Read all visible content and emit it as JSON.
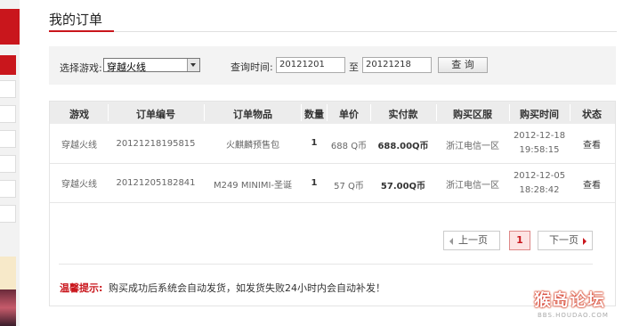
{
  "page": {
    "title": "我的订单"
  },
  "filter": {
    "game_label": "选择游戏:",
    "game_value": "穿越火线",
    "time_label": "查询时间:",
    "date_from": "20121201",
    "date_sep": "至",
    "date_to": "20121218",
    "query_button": "查 询"
  },
  "table": {
    "headers": [
      "游戏",
      "订单编号",
      "订单物品",
      "数量",
      "单价",
      "实付款",
      "购买区服",
      "购买时间",
      "状态"
    ],
    "rows": [
      {
        "game": "穿越火线",
        "order_no": "20121218195815",
        "item": "火麒麟预售包",
        "qty": "1",
        "unit_price": "688 Q币",
        "paid": "688.00Q币",
        "server": "浙江电信一区",
        "date": "2012-12-18",
        "time": "19:58:15",
        "status": "查看"
      },
      {
        "game": "穿越火线",
        "order_no": "20121205182841",
        "item": "M249 MINIMI-圣诞",
        "qty": "1",
        "unit_price": "57 Q币",
        "paid": "57.00Q币",
        "server": "浙江电信一区",
        "date": "2012-12-05",
        "time": "18:28:42",
        "status": "查看"
      }
    ]
  },
  "pager": {
    "prev": "上一页",
    "current": "1",
    "next": "下一页"
  },
  "tip": {
    "label": "温馨提示:",
    "text": "购买成功后系统会自动发货，如发货失败24小时内会自动补发！"
  },
  "watermark": {
    "logo": "猴岛论坛",
    "url": "BBS.HOUDAO.COM"
  },
  "colors": {
    "accent": "#c9161c"
  }
}
